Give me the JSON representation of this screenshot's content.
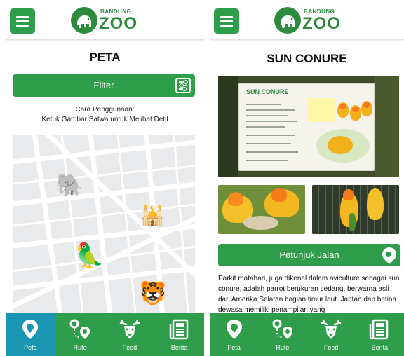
{
  "brand": {
    "logo_small": "BANDUNG",
    "logo_big": "ZOO",
    "accent": "#2e9e4a",
    "active_tab_color": "#1b96b2"
  },
  "left_screen": {
    "title": "PETA",
    "filter_label": "Filter",
    "help_title": "Cara Penggunaan:",
    "help_text": "Ketuk Gambar Satwa untuk Melihat Detil",
    "map_markers": [
      {
        "name": "elephant",
        "glyph": "🐘"
      },
      {
        "name": "mosque",
        "glyph": "🕌"
      },
      {
        "name": "parrot",
        "glyph": "🦜"
      },
      {
        "name": "tiger",
        "glyph": "🐯"
      }
    ]
  },
  "right_screen": {
    "title": "SUN CONURE",
    "sign_title": "SUN CONURE",
    "button_label": "Petunjuk Jalan",
    "description": "Parkit matahari, juga dikenal dalam aviculture sebagai sun conure, adalah parrot berukuran sedang, berwarna asli dari Amerika Selatan bagian timur laut. Jantan dan betina dewasa memiliki penampilan yang"
  },
  "bottom_nav": [
    {
      "label": "Peta",
      "icon": "map-pin-icon"
    },
    {
      "label": "Rute",
      "icon": "route-icon"
    },
    {
      "label": "Feed",
      "icon": "deer-icon"
    },
    {
      "label": "Berita",
      "icon": "newspaper-icon"
    }
  ]
}
